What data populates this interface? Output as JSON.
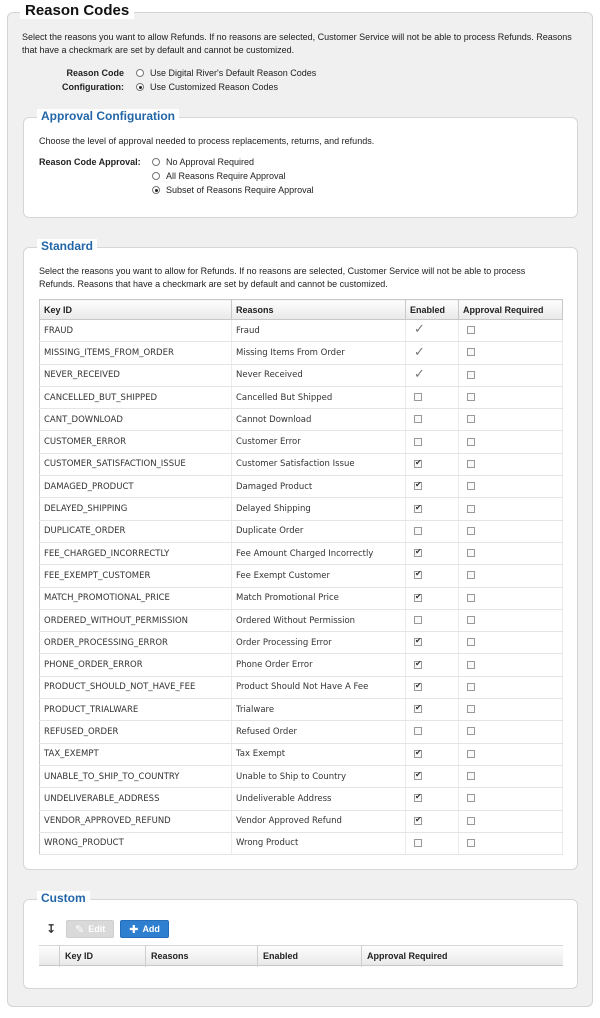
{
  "title": "Reason Codes",
  "intro": "Select the reasons you want to allow Refunds. If no reasons are selected, Customer Service will not be able to process Refunds. Reasons that have a checkmark are set by default and cannot be customized.",
  "reason_code_config": {
    "label_line1": "Reason Code",
    "label_line2": "Configuration:",
    "options": [
      {
        "label": "Use Digital River's Default Reason Codes",
        "selected": false
      },
      {
        "label": "Use Customized Reason Codes",
        "selected": true
      }
    ]
  },
  "approval": {
    "title": "Approval Configuration",
    "description": "Choose the level of approval needed to process replacements, returns, and refunds.",
    "label": "Reason Code Approval:",
    "options": [
      {
        "label": "No Approval Required",
        "selected": false
      },
      {
        "label": "All Reasons Require Approval",
        "selected": false
      },
      {
        "label": "Subset of Reasons Require Approval",
        "selected": true
      }
    ]
  },
  "standard": {
    "title": "Standard",
    "description": "Select the reasons you want to allow for Refunds. If no reasons are selected, Customer Service will not be able to process Refunds. Reasons that have a checkmark are set by default and cannot be customized.",
    "columns": [
      "Key ID",
      "Reasons",
      "Enabled",
      "Approval Required"
    ],
    "rows": [
      {
        "key": "FRAUD",
        "reason": "Fraud",
        "enabled": "default",
        "approval": false
      },
      {
        "key": "MISSING_ITEMS_FROM_ORDER",
        "reason": "Missing Items From Order",
        "enabled": "default",
        "approval": false
      },
      {
        "key": "NEVER_RECEIVED",
        "reason": "Never Received",
        "enabled": "default",
        "approval": false
      },
      {
        "key": "CANCELLED_BUT_SHIPPED",
        "reason": "Cancelled But Shipped",
        "enabled": "off",
        "approval": false
      },
      {
        "key": "CANT_DOWNLOAD",
        "reason": "Cannot Download",
        "enabled": "off",
        "approval": false
      },
      {
        "key": "CUSTOMER_ERROR",
        "reason": "Customer Error",
        "enabled": "off",
        "approval": false
      },
      {
        "key": "CUSTOMER_SATISFACTION_ISSUE",
        "reason": "Customer Satisfaction Issue",
        "enabled": "on",
        "approval": false
      },
      {
        "key": "DAMAGED_PRODUCT",
        "reason": "Damaged Product",
        "enabled": "on",
        "approval": false
      },
      {
        "key": "DELAYED_SHIPPING",
        "reason": "Delayed Shipping",
        "enabled": "on",
        "approval": false
      },
      {
        "key": "DUPLICATE_ORDER",
        "reason": "Duplicate Order",
        "enabled": "off",
        "approval": false
      },
      {
        "key": "FEE_CHARGED_INCORRECTLY",
        "reason": "Fee Amount Charged Incorrectly",
        "enabled": "on",
        "approval": false
      },
      {
        "key": "FEE_EXEMPT_CUSTOMER",
        "reason": "Fee Exempt Customer",
        "enabled": "on",
        "approval": false
      },
      {
        "key": "MATCH_PROMOTIONAL_PRICE",
        "reason": "Match Promotional Price",
        "enabled": "on",
        "approval": false
      },
      {
        "key": "ORDERED_WITHOUT_PERMISSION",
        "reason": "Ordered Without Permission",
        "enabled": "off",
        "approval": false
      },
      {
        "key": "ORDER_PROCESSING_ERROR",
        "reason": "Order Processing Error",
        "enabled": "on",
        "approval": false
      },
      {
        "key": "PHONE_ORDER_ERROR",
        "reason": "Phone Order Error",
        "enabled": "on",
        "approval": false
      },
      {
        "key": "PRODUCT_SHOULD_NOT_HAVE_FEE",
        "reason": "Product Should Not Have A Fee",
        "enabled": "on",
        "approval": false
      },
      {
        "key": "PRODUCT_TRIALWARE",
        "reason": "Trialware",
        "enabled": "on",
        "approval": false
      },
      {
        "key": "REFUSED_ORDER",
        "reason": "Refused Order",
        "enabled": "off",
        "approval": false
      },
      {
        "key": "TAX_EXEMPT",
        "reason": "Tax Exempt",
        "enabled": "on",
        "approval": false
      },
      {
        "key": "UNABLE_TO_SHIP_TO_COUNTRY",
        "reason": "Unable to Ship to Country",
        "enabled": "on",
        "approval": false
      },
      {
        "key": "UNDELIVERABLE_ADDRESS",
        "reason": "Undeliverable Address",
        "enabled": "on",
        "approval": false
      },
      {
        "key": "VENDOR_APPROVED_REFUND",
        "reason": "Vendor Approved Refund",
        "enabled": "on",
        "approval": false
      },
      {
        "key": "WRONG_PRODUCT",
        "reason": "Wrong Product",
        "enabled": "off",
        "approval": false
      }
    ]
  },
  "custom": {
    "title": "Custom",
    "edit_label": "Edit",
    "add_label": "Add",
    "columns": [
      "Key ID",
      "Reasons",
      "Enabled",
      "Approval Required"
    ]
  },
  "colors": {
    "accent": "#2266a8",
    "button_primary": "#2f7fd0"
  },
  "icons": {
    "sort": "sort-down-icon",
    "edit": "pencil-icon",
    "add": "plus-icon"
  }
}
